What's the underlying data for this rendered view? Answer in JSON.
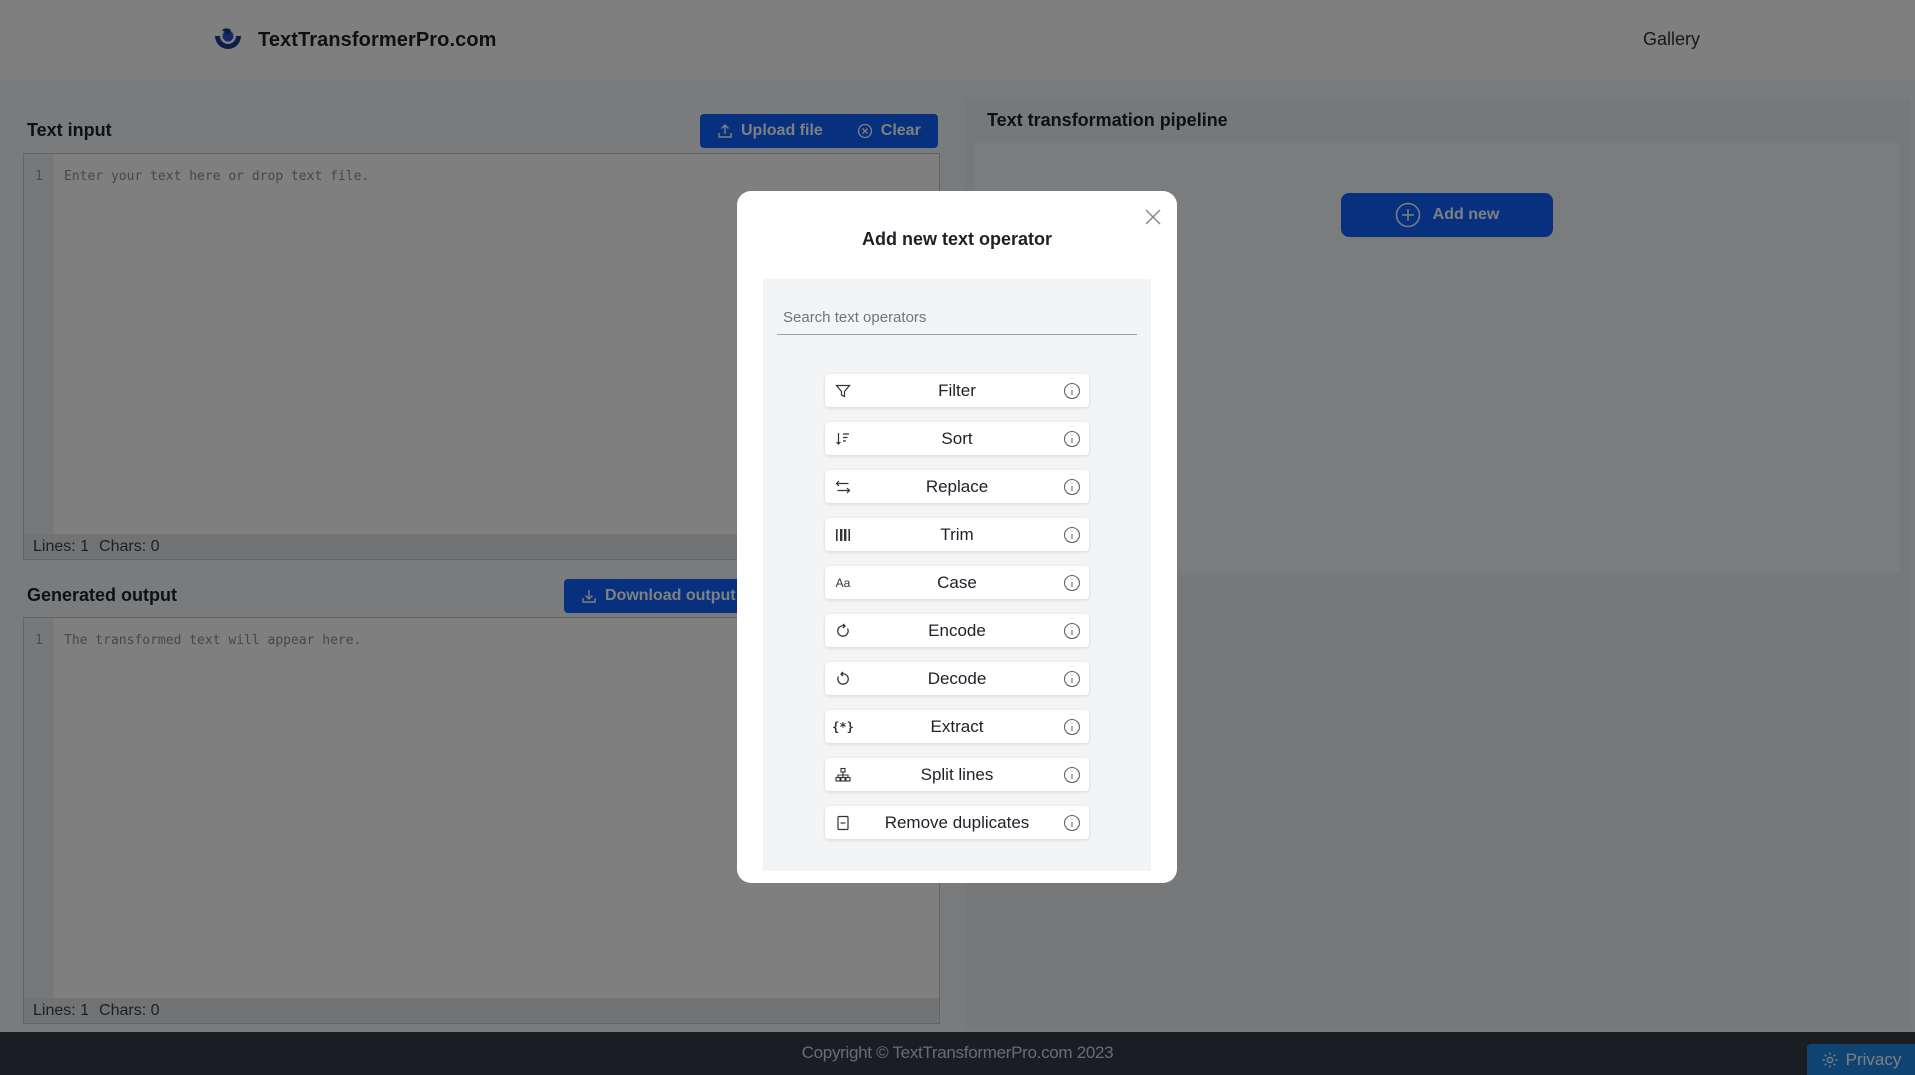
{
  "header": {
    "brand_name": "TextTransformerPro.com",
    "nav_gallery": "Gallery"
  },
  "input_section": {
    "title": "Text input",
    "upload_label": "Upload file",
    "clear_label": "Clear",
    "line_number": "1",
    "placeholder": "Enter your text here or drop text file.",
    "status_lines": "Lines: 1",
    "status_chars": "Chars: 0"
  },
  "output_section": {
    "title": "Generated output",
    "download_label": "Download output",
    "line_number": "1",
    "placeholder": "The transformed text will appear here.",
    "status_lines": "Lines: 1",
    "status_chars": "Chars: 0"
  },
  "pipeline": {
    "title": "Text transformation pipeline",
    "add_new_label": "Add new"
  },
  "modal": {
    "title": "Add new text operator",
    "search_placeholder": "Search text operators",
    "operators": [
      {
        "label": "Filter",
        "icon": "filter-icon"
      },
      {
        "label": "Sort",
        "icon": "sort-icon"
      },
      {
        "label": "Replace",
        "icon": "replace-icon"
      },
      {
        "label": "Trim",
        "icon": "trim-icon"
      },
      {
        "label": "Case",
        "icon": "case-icon"
      },
      {
        "label": "Encode",
        "icon": "encode-icon"
      },
      {
        "label": "Decode",
        "icon": "decode-icon"
      },
      {
        "label": "Extract",
        "icon": "extract-icon"
      },
      {
        "label": "Split lines",
        "icon": "split-lines-icon"
      },
      {
        "label": "Remove duplicates",
        "icon": "remove-duplicates-icon"
      }
    ]
  },
  "footer": {
    "copyright": "Copyright © TextTransformerPro.com 2023",
    "privacy_label": "Privacy"
  },
  "colors": {
    "accent": "#0f62fe",
    "footer_bg": "#353a42",
    "privacy_bg": "#1e88e5"
  }
}
